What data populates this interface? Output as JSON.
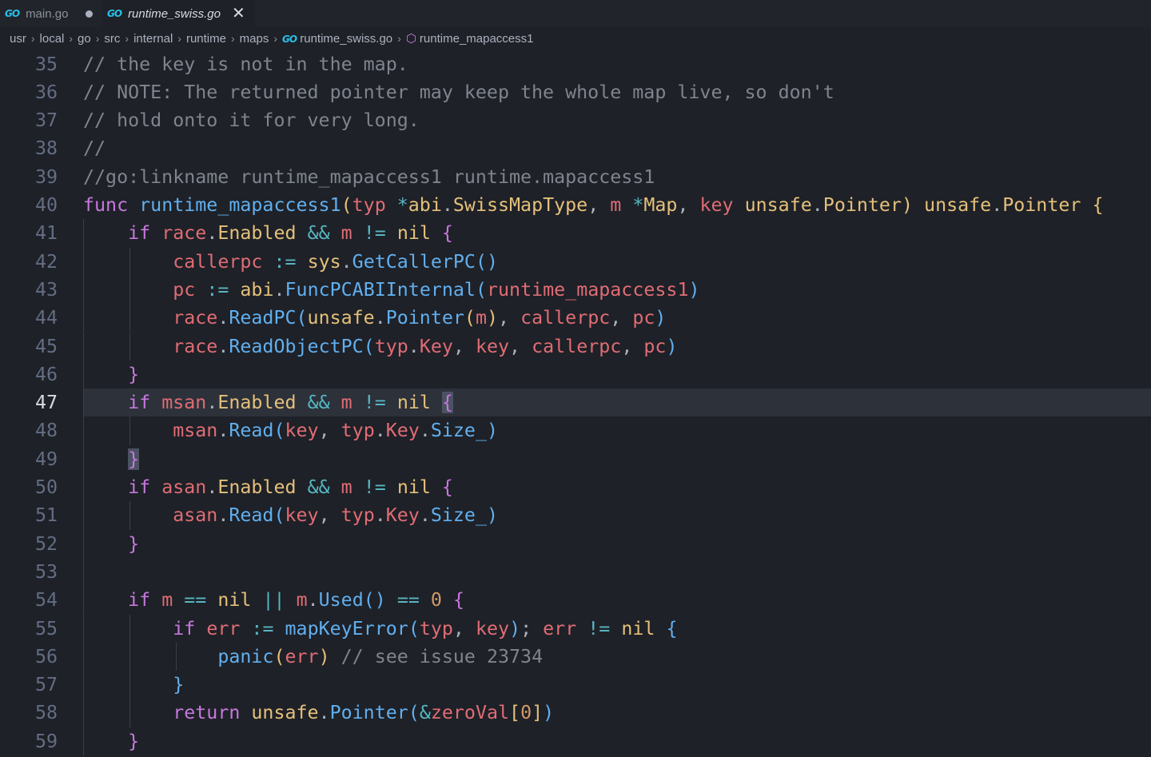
{
  "tabs": [
    {
      "icon": "GO",
      "label": "main.go",
      "dirty": true,
      "active": false
    },
    {
      "icon": "GO",
      "label": "runtime_swiss.go",
      "dirty": false,
      "active": true,
      "close": "✕"
    }
  ],
  "breadcrumb": {
    "segments": [
      "usr",
      "local",
      "go",
      "src",
      "internal",
      "runtime",
      "maps"
    ],
    "file": "runtime_swiss.go",
    "symbol": "runtime_mapaccess1",
    "separator": "›"
  },
  "editor": {
    "current_line": 47,
    "lines": [
      {
        "n": "35",
        "tokens": [
          [
            "c",
            "// the key is not in the map."
          ]
        ]
      },
      {
        "n": "36",
        "tokens": [
          [
            "c",
            "// NOTE: The returned pointer may keep the whole map live, so don't"
          ]
        ]
      },
      {
        "n": "37",
        "tokens": [
          [
            "c",
            "// hold onto it for very long."
          ]
        ]
      },
      {
        "n": "38",
        "tokens": [
          [
            "c",
            "//"
          ]
        ]
      },
      {
        "n": "39",
        "tokens": [
          [
            "c",
            "//go:linkname runtime_mapaccess1 runtime.mapaccess1"
          ]
        ]
      },
      {
        "n": "40",
        "tokens": [
          [
            "k",
            "func"
          ],
          [
            "p",
            " "
          ],
          [
            "f",
            "runtime_mapaccess1"
          ],
          [
            "b1",
            "("
          ],
          [
            "v",
            "typ"
          ],
          [
            "p",
            " "
          ],
          [
            "o",
            "*"
          ],
          [
            "t",
            "abi"
          ],
          [
            "p",
            "."
          ],
          [
            "t",
            "SwissMapType"
          ],
          [
            "p",
            ", "
          ],
          [
            "v",
            "m"
          ],
          [
            "p",
            " "
          ],
          [
            "o",
            "*"
          ],
          [
            "t",
            "Map"
          ],
          [
            "p",
            ", "
          ],
          [
            "v",
            "key"
          ],
          [
            "p",
            " "
          ],
          [
            "t",
            "unsafe"
          ],
          [
            "p",
            "."
          ],
          [
            "t",
            "Pointer"
          ],
          [
            "b1",
            ")"
          ],
          [
            "p",
            " "
          ],
          [
            "t",
            "unsafe"
          ],
          [
            "p",
            "."
          ],
          [
            "t",
            "Pointer"
          ],
          [
            "p",
            " "
          ],
          [
            "b1",
            "{"
          ]
        ]
      },
      {
        "n": "41",
        "indent": 1,
        "tokens": [
          [
            "k",
            "if"
          ],
          [
            "p",
            " "
          ],
          [
            "v",
            "race"
          ],
          [
            "p",
            "."
          ],
          [
            "t",
            "Enabled"
          ],
          [
            "p",
            " "
          ],
          [
            "o",
            "&&"
          ],
          [
            "p",
            " "
          ],
          [
            "v",
            "m"
          ],
          [
            "p",
            " "
          ],
          [
            "o",
            "!="
          ],
          [
            "p",
            " "
          ],
          [
            "t",
            "nil"
          ],
          [
            "p",
            " "
          ],
          [
            "b2",
            "{"
          ]
        ]
      },
      {
        "n": "42",
        "indent": 2,
        "tokens": [
          [
            "v",
            "callerpc"
          ],
          [
            "p",
            " "
          ],
          [
            "o",
            ":="
          ],
          [
            "p",
            " "
          ],
          [
            "t",
            "sys"
          ],
          [
            "p",
            "."
          ],
          [
            "f",
            "GetCallerPC"
          ],
          [
            "b3",
            "()"
          ]
        ]
      },
      {
        "n": "43",
        "indent": 2,
        "tokens": [
          [
            "v",
            "pc"
          ],
          [
            "p",
            " "
          ],
          [
            "o",
            ":="
          ],
          [
            "p",
            " "
          ],
          [
            "t",
            "abi"
          ],
          [
            "p",
            "."
          ],
          [
            "f",
            "FuncPCABIInternal"
          ],
          [
            "b3",
            "("
          ],
          [
            "v",
            "runtime_mapaccess1"
          ],
          [
            "b3",
            ")"
          ]
        ]
      },
      {
        "n": "44",
        "indent": 2,
        "tokens": [
          [
            "v",
            "race"
          ],
          [
            "p",
            "."
          ],
          [
            "f",
            "ReadPC"
          ],
          [
            "b3",
            "("
          ],
          [
            "t",
            "unsafe"
          ],
          [
            "p",
            "."
          ],
          [
            "f",
            "Pointer"
          ],
          [
            "b1",
            "("
          ],
          [
            "v",
            "m"
          ],
          [
            "b1",
            ")"
          ],
          [
            "p",
            ", "
          ],
          [
            "v",
            "callerpc"
          ],
          [
            "p",
            ", "
          ],
          [
            "v",
            "pc"
          ],
          [
            "b3",
            ")"
          ]
        ]
      },
      {
        "n": "45",
        "indent": 2,
        "tokens": [
          [
            "v",
            "race"
          ],
          [
            "p",
            "."
          ],
          [
            "f",
            "ReadObjectPC"
          ],
          [
            "b3",
            "("
          ],
          [
            "v",
            "typ"
          ],
          [
            "p",
            "."
          ],
          [
            "v",
            "Key"
          ],
          [
            "p",
            ", "
          ],
          [
            "v",
            "key"
          ],
          [
            "p",
            ", "
          ],
          [
            "v",
            "callerpc"
          ],
          [
            "p",
            ", "
          ],
          [
            "v",
            "pc"
          ],
          [
            "b3",
            ")"
          ]
        ]
      },
      {
        "n": "46",
        "indent": 1,
        "tokens": [
          [
            "b2",
            "}"
          ]
        ]
      },
      {
        "n": "47",
        "indent": 1,
        "tokens": [
          [
            "k",
            "if"
          ],
          [
            "p",
            " "
          ],
          [
            "v",
            "msan"
          ],
          [
            "p",
            "."
          ],
          [
            "t",
            "Enabled"
          ],
          [
            "p",
            " "
          ],
          [
            "o",
            "&&"
          ],
          [
            "p",
            " "
          ],
          [
            "v",
            "m"
          ],
          [
            "p",
            " "
          ],
          [
            "o",
            "!="
          ],
          [
            "p",
            " "
          ],
          [
            "t",
            "nil"
          ],
          [
            "p",
            " "
          ],
          [
            "b2 bmatch",
            "{"
          ]
        ]
      },
      {
        "n": "48",
        "indent": 2,
        "tokens": [
          [
            "v",
            "msan"
          ],
          [
            "p",
            "."
          ],
          [
            "f",
            "Read"
          ],
          [
            "b3",
            "("
          ],
          [
            "v",
            "key"
          ],
          [
            "p",
            ", "
          ],
          [
            "v",
            "typ"
          ],
          [
            "p",
            "."
          ],
          [
            "v",
            "Key"
          ],
          [
            "p",
            "."
          ],
          [
            "f",
            "Size_"
          ],
          [
            "b3",
            ")"
          ]
        ]
      },
      {
        "n": "49",
        "indent": 1,
        "tokens": [
          [
            "b2 bmatch",
            "}"
          ]
        ]
      },
      {
        "n": "50",
        "indent": 1,
        "tokens": [
          [
            "k",
            "if"
          ],
          [
            "p",
            " "
          ],
          [
            "v",
            "asan"
          ],
          [
            "p",
            "."
          ],
          [
            "t",
            "Enabled"
          ],
          [
            "p",
            " "
          ],
          [
            "o",
            "&&"
          ],
          [
            "p",
            " "
          ],
          [
            "v",
            "m"
          ],
          [
            "p",
            " "
          ],
          [
            "o",
            "!="
          ],
          [
            "p",
            " "
          ],
          [
            "t",
            "nil"
          ],
          [
            "p",
            " "
          ],
          [
            "b2",
            "{"
          ]
        ]
      },
      {
        "n": "51",
        "indent": 2,
        "tokens": [
          [
            "v",
            "asan"
          ],
          [
            "p",
            "."
          ],
          [
            "f",
            "Read"
          ],
          [
            "b3",
            "("
          ],
          [
            "v",
            "key"
          ],
          [
            "p",
            ", "
          ],
          [
            "v",
            "typ"
          ],
          [
            "p",
            "."
          ],
          [
            "v",
            "Key"
          ],
          [
            "p",
            "."
          ],
          [
            "f",
            "Size_"
          ],
          [
            "b3",
            ")"
          ]
        ]
      },
      {
        "n": "52",
        "indent": 1,
        "tokens": [
          [
            "b2",
            "}"
          ]
        ]
      },
      {
        "n": "53",
        "indent": 1,
        "tokens": []
      },
      {
        "n": "54",
        "indent": 1,
        "tokens": [
          [
            "k",
            "if"
          ],
          [
            "p",
            " "
          ],
          [
            "v",
            "m"
          ],
          [
            "p",
            " "
          ],
          [
            "o",
            "=="
          ],
          [
            "p",
            " "
          ],
          [
            "t",
            "nil"
          ],
          [
            "p",
            " "
          ],
          [
            "o",
            "||"
          ],
          [
            "p",
            " "
          ],
          [
            "v",
            "m"
          ],
          [
            "p",
            "."
          ],
          [
            "f",
            "Used"
          ],
          [
            "b3",
            "()"
          ],
          [
            "p",
            " "
          ],
          [
            "o",
            "=="
          ],
          [
            "p",
            " "
          ],
          [
            "n",
            "0"
          ],
          [
            "p",
            " "
          ],
          [
            "b2",
            "{"
          ]
        ]
      },
      {
        "n": "55",
        "indent": 2,
        "tokens": [
          [
            "k",
            "if"
          ],
          [
            "p",
            " "
          ],
          [
            "v",
            "err"
          ],
          [
            "p",
            " "
          ],
          [
            "o",
            ":="
          ],
          [
            "p",
            " "
          ],
          [
            "f",
            "mapKeyError"
          ],
          [
            "b3",
            "("
          ],
          [
            "v",
            "typ"
          ],
          [
            "p",
            ", "
          ],
          [
            "v",
            "key"
          ],
          [
            "b3",
            ")"
          ],
          [
            "p",
            "; "
          ],
          [
            "v",
            "err"
          ],
          [
            "p",
            " "
          ],
          [
            "o",
            "!="
          ],
          [
            "p",
            " "
          ],
          [
            "t",
            "nil"
          ],
          [
            "p",
            " "
          ],
          [
            "b3",
            "{"
          ]
        ]
      },
      {
        "n": "56",
        "indent": 3,
        "tokens": [
          [
            "f",
            "panic"
          ],
          [
            "b1",
            "("
          ],
          [
            "v",
            "err"
          ],
          [
            "b1",
            ")"
          ],
          [
            "p",
            " "
          ],
          [
            "c",
            "// see issue 23734"
          ]
        ]
      },
      {
        "n": "57",
        "indent": 2,
        "tokens": [
          [
            "b3",
            "}"
          ]
        ]
      },
      {
        "n": "58",
        "indent": 2,
        "tokens": [
          [
            "k",
            "return"
          ],
          [
            "p",
            " "
          ],
          [
            "t",
            "unsafe"
          ],
          [
            "p",
            "."
          ],
          [
            "f",
            "Pointer"
          ],
          [
            "b3",
            "("
          ],
          [
            "o",
            "&"
          ],
          [
            "v",
            "zeroVal"
          ],
          [
            "b1",
            "["
          ],
          [
            "n",
            "0"
          ],
          [
            "b1",
            "]"
          ],
          [
            "b3",
            ")"
          ]
        ]
      },
      {
        "n": "59",
        "indent": 1,
        "tokens": [
          [
            "b2",
            "}"
          ]
        ]
      }
    ]
  }
}
